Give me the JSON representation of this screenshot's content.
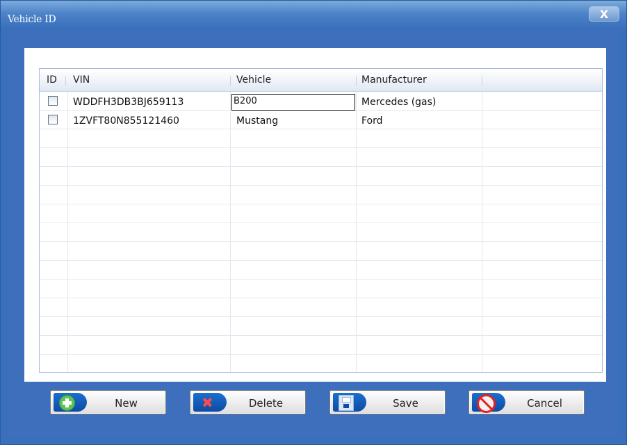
{
  "window": {
    "title": "Vehicle ID",
    "close_glyph": "X"
  },
  "table": {
    "columns": [
      "ID",
      "VIN",
      "Vehicle",
      "Manufacturer"
    ],
    "rows": [
      {
        "checked": false,
        "vin": "WDDFH3DB3BJ659113",
        "vehicle": "B200",
        "manufacturer": "Mercedes (gas)",
        "editing": true
      },
      {
        "checked": false,
        "vin": "1ZVFT80N855121460",
        "vehicle": "Mustang",
        "manufacturer": "Ford",
        "editing": false
      }
    ]
  },
  "buttons": {
    "new": "New",
    "delete": "Delete",
    "save": "Save",
    "cancel": "Cancel"
  },
  "icons": {
    "new": "plus-icon",
    "delete": "delete-x-icon",
    "save": "floppy-disk-icon",
    "cancel": "stop-icon"
  },
  "colors": {
    "window_frame": "#3e6fbc",
    "button_icon_bg": "#1a6fd0"
  }
}
